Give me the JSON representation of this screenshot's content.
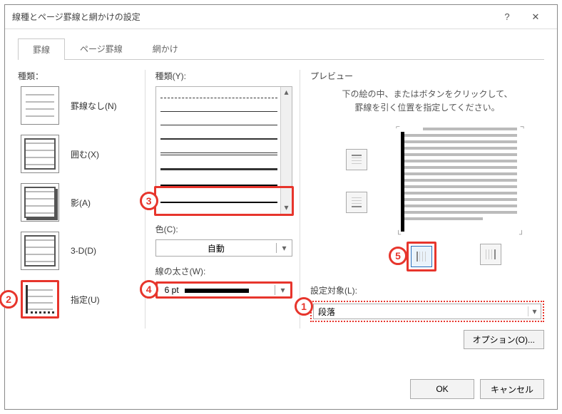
{
  "window": {
    "title": "線種とページ罫線と網かけの設定"
  },
  "tabs": {
    "borders": "罫線",
    "page_borders": "ページ罫線",
    "shading": "網かけ"
  },
  "type": {
    "label": "種類：",
    "items": [
      {
        "label": "罫線なし(N)"
      },
      {
        "label": "囲む(X)"
      },
      {
        "label": "影(A)"
      },
      {
        "label": "3-D(D)"
      },
      {
        "label": "指定(U)"
      }
    ]
  },
  "style": {
    "label": "種類(Y):"
  },
  "color": {
    "label": "色(C):",
    "value": "自動"
  },
  "width": {
    "label": "線の太さ(W):",
    "value": "6 pt"
  },
  "preview": {
    "label": "プレビュー",
    "hint1": "下の絵の中、またはボタンをクリックして、",
    "hint2": "罫線を引く位置を指定してください。"
  },
  "apply": {
    "label": "設定対象(L):",
    "value": "段落"
  },
  "buttons": {
    "options": "オプション(O)...",
    "ok": "OK",
    "cancel": "キャンセル"
  },
  "callouts": {
    "c1": "1",
    "c2": "2",
    "c3": "3",
    "c4": "4",
    "c5": "5"
  }
}
